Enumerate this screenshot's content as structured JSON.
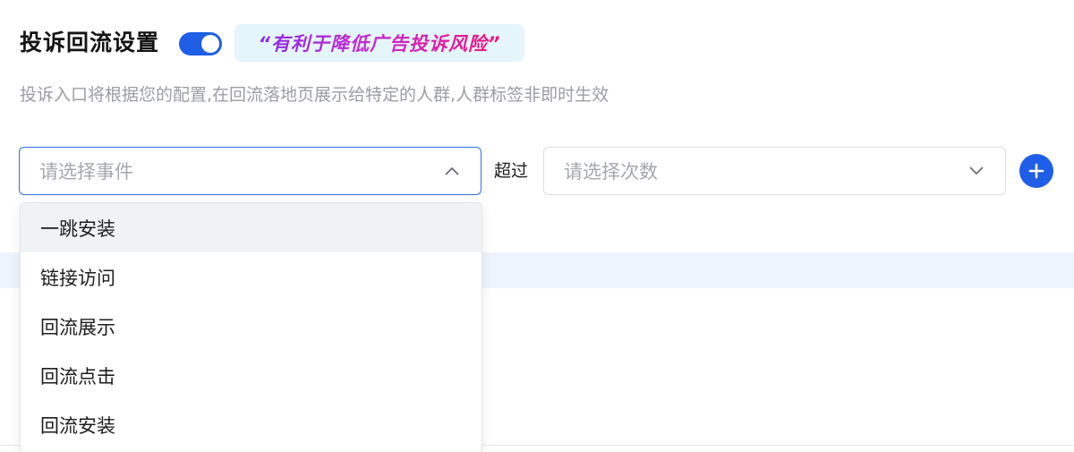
{
  "header": {
    "title": "投诉回流设置",
    "toggle_on": true,
    "slogan": "“有利于降低广告投诉风险”",
    "description": "投诉入口将根据您的配置,在回流落地页展示给特定的人群,人群标签非即时生效"
  },
  "condition": {
    "event_select": {
      "placeholder": "请选择事件",
      "expanded": true,
      "icon": "chevron-up-icon"
    },
    "exceed_label": "超过",
    "count_select": {
      "placeholder": "请选择次数",
      "expanded": false,
      "icon": "chevron-down-icon"
    },
    "add_icon": "plus-circle-icon"
  },
  "dropdown": {
    "options": [
      {
        "label": "一跳安装",
        "hovered": true
      },
      {
        "label": "链接访问",
        "hovered": false
      },
      {
        "label": "回流展示",
        "hovered": false
      },
      {
        "label": "回流点击",
        "hovered": false
      },
      {
        "label": "回流安装",
        "hovered": false
      }
    ]
  },
  "colors": {
    "accent": "#1f5ee6",
    "slogan_bg": "#e4f5fb",
    "description": "#9b9da2",
    "placeholder": "#a4a7ad"
  }
}
